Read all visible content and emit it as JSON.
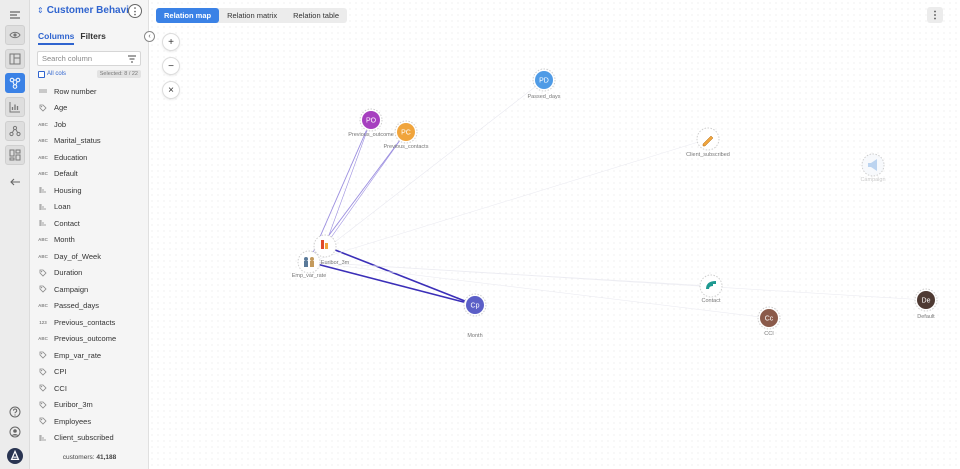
{
  "rail": {
    "icons": [
      "menu-icon",
      "eye-icon",
      "layout-icon",
      "relation-icon",
      "chart-icon",
      "graph-icon",
      "dashboard-icon",
      "back-icon",
      "help-icon",
      "user-icon",
      "logo-icon"
    ]
  },
  "panel": {
    "dataset_name": "Customer Behavio...",
    "tabs": [
      "Columns",
      "Filters"
    ],
    "search_placeholder": "Search column",
    "all_cols_label": "All cols",
    "selected_label": "Selected: 8 / 22",
    "columns": [
      {
        "name": "Row number",
        "type": "id"
      },
      {
        "name": "Age",
        "type": "num"
      },
      {
        "name": "Job",
        "type": "text"
      },
      {
        "name": "Marital_status",
        "type": "text"
      },
      {
        "name": "Education",
        "type": "text"
      },
      {
        "name": "Default",
        "type": "text"
      },
      {
        "name": "Housing",
        "type": "bool"
      },
      {
        "name": "Loan",
        "type": "bool"
      },
      {
        "name": "Contact",
        "type": "bool"
      },
      {
        "name": "Month",
        "type": "text"
      },
      {
        "name": "Day_of_Week",
        "type": "text"
      },
      {
        "name": "Duration",
        "type": "num"
      },
      {
        "name": "Campaign",
        "type": "num"
      },
      {
        "name": "Passed_days",
        "type": "text"
      },
      {
        "name": "Previous_contacts",
        "type": "int"
      },
      {
        "name": "Previous_outcome",
        "type": "text"
      },
      {
        "name": "Emp_var_rate",
        "type": "num"
      },
      {
        "name": "CPI",
        "type": "num"
      },
      {
        "name": "CCI",
        "type": "num"
      },
      {
        "name": "Euribor_3m",
        "type": "num"
      },
      {
        "name": "Employees",
        "type": "num"
      },
      {
        "name": "Client_subscribed",
        "type": "bool"
      }
    ],
    "count_label": "customers:",
    "count_value": "41,188"
  },
  "main": {
    "view_tabs": [
      "Relation map",
      "Relation matrix",
      "Relation table"
    ],
    "active_view": 0,
    "zoom_in": "+",
    "zoom_out": "−",
    "reset": "×",
    "more": "⋮"
  },
  "graph": {
    "colors": {
      "PD": "#4f9be6",
      "PO": "#a63fbf",
      "PC": "#f0a43c",
      "Cp": "#5b5fc7",
      "Cc": "#8a5a4a",
      "De": "#4e3a33",
      "Contact": "#1e9990",
      "strong_edge": "#3b2fb8"
    },
    "nodes": [
      {
        "id": "PD",
        "text": "PD",
        "label": "Passed_days"
      },
      {
        "id": "PO",
        "text": "PO",
        "label": "Previous_outcome"
      },
      {
        "id": "PC",
        "text": "PC",
        "label": "Previous_contacts"
      },
      {
        "id": "CS",
        "text": "",
        "label": "Client_subscribed",
        "icon": "pencil-icon"
      },
      {
        "id": "CA",
        "text": "",
        "label": "Campaign",
        "icon": "megaphone-icon"
      },
      {
        "id": "EM",
        "text": "",
        "label": "Emp_var_rate",
        "icon": "people-icon"
      },
      {
        "id": "EU",
        "text": "",
        "label": "Euribor_3m",
        "icon": "bar-icon"
      },
      {
        "id": "Cp",
        "text": "Cp",
        "label": "Month"
      },
      {
        "id": "CT",
        "text": "",
        "label": "Contact",
        "icon": "phone-icon"
      },
      {
        "id": "Cc",
        "text": "Cc",
        "label": "CCI"
      },
      {
        "id": "De",
        "text": "De",
        "label": "Default"
      }
    ]
  }
}
